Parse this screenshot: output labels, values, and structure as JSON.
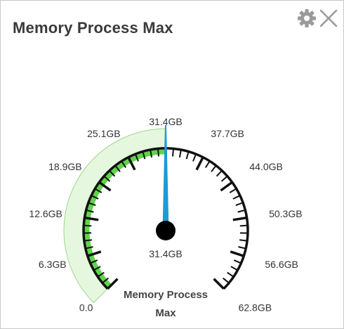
{
  "widget": {
    "title": "Memory Process Max",
    "settings_icon": "gear-icon",
    "close_icon": "close-icon"
  },
  "gauge": {
    "min": 0.0,
    "max": 62.8,
    "value": 31.4,
    "value_label": "31.4GB",
    "label_line1": "Memory Process",
    "label_line2": "Max",
    "tick_labels": [
      "0.0",
      "6.3GB",
      "12.6GB",
      "18.9GB",
      "25.1GB",
      "31.4GB",
      "37.7GB",
      "44.0GB",
      "50.3GB",
      "56.6GB",
      "62.8GB"
    ],
    "colors": {
      "band_fill": "#e6f7df",
      "band_stroke": "#9ad98a",
      "value_arc": "#5fd44a",
      "needle": "#1e9ad6",
      "pivot": "#000000",
      "ticks": "#111111"
    }
  }
}
